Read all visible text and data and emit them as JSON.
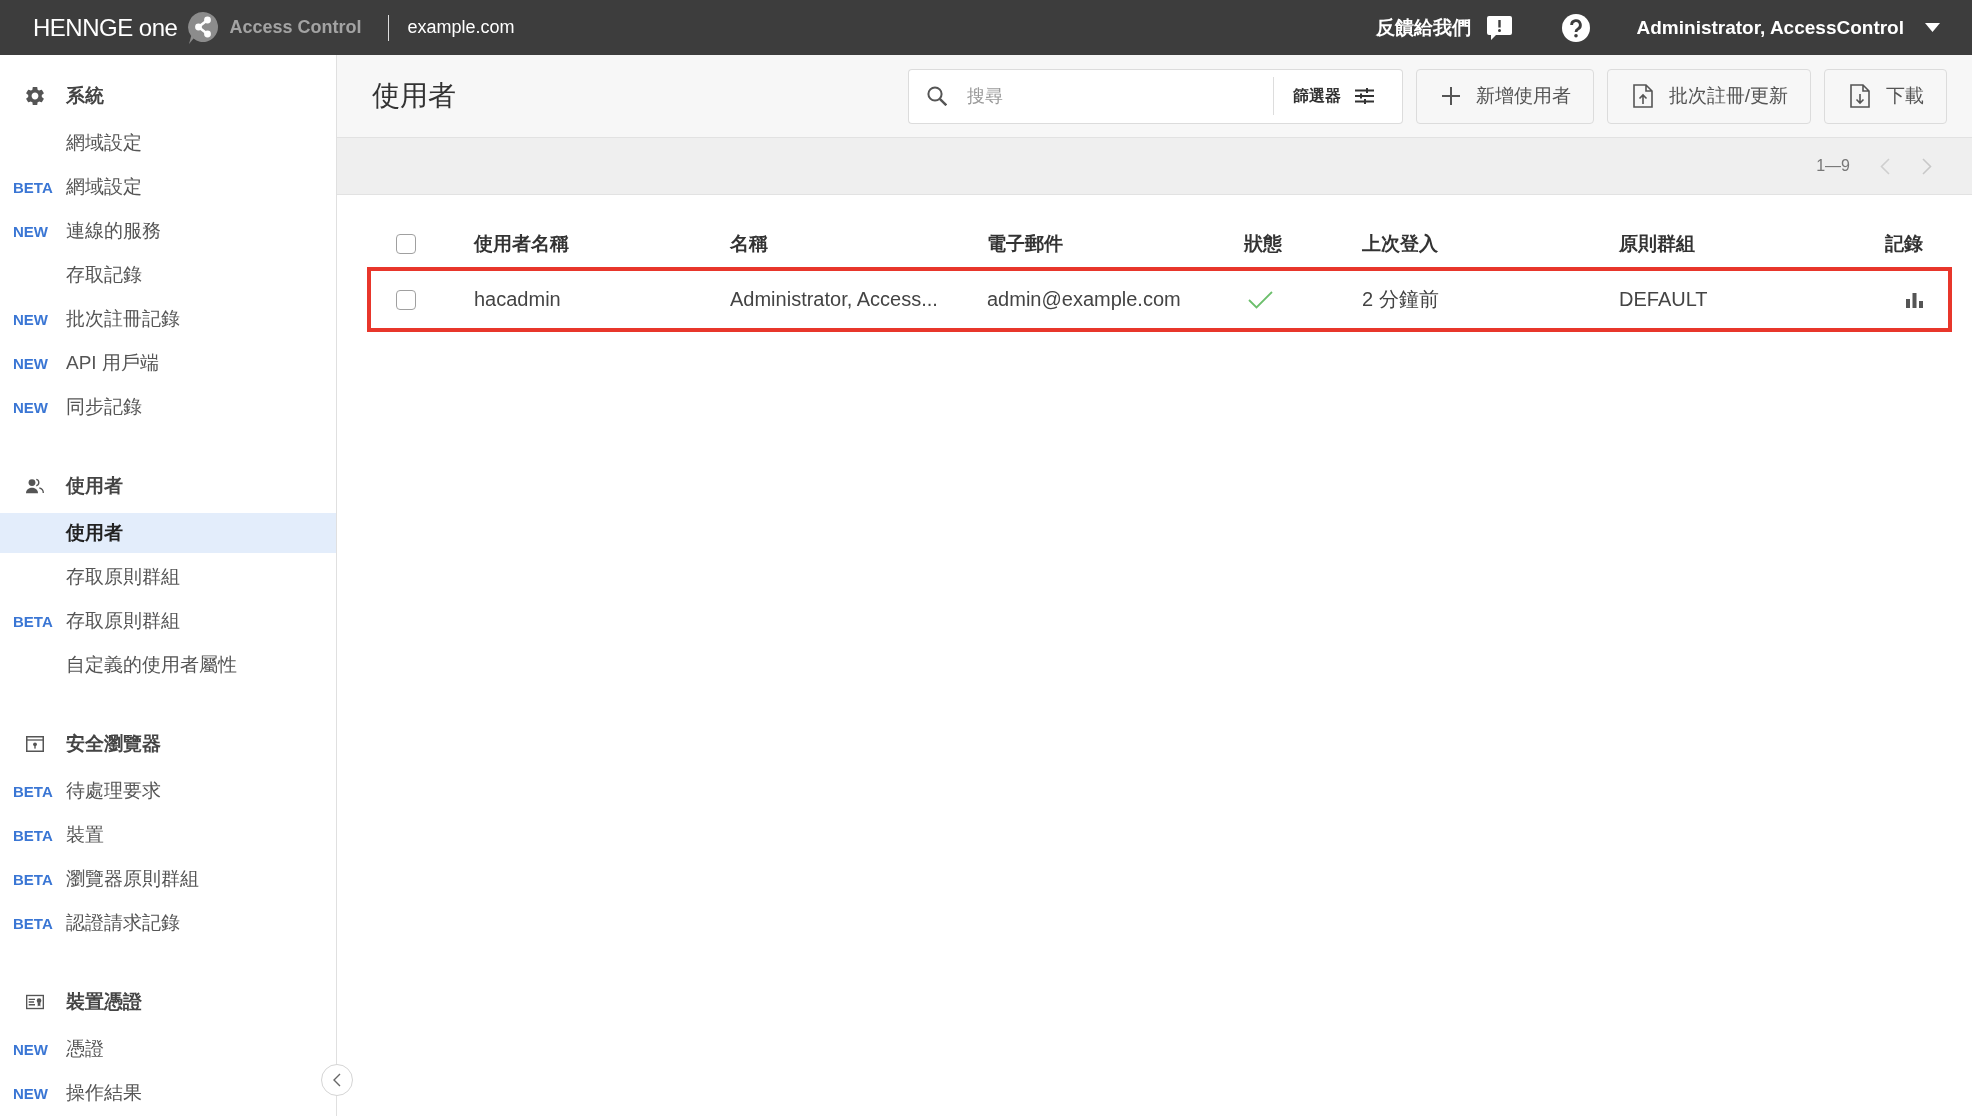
{
  "top_bar": {
    "logo": "HENNGE one",
    "product": "Access Control",
    "domain": "example.com",
    "feedback": "反饋給我們",
    "account": "Administrator, AccessControl"
  },
  "sidebar": {
    "sections": [
      {
        "title": "系統",
        "items": [
          {
            "label": "網域設定",
            "selected": false
          },
          {
            "badge": "BETA",
            "label": "網域設定",
            "selected": false
          },
          {
            "badge": "NEW",
            "label": "連線的服務",
            "selected": false
          },
          {
            "label": "存取記錄",
            "selected": false
          },
          {
            "badge": "NEW",
            "label": "批次註冊記錄",
            "selected": false
          },
          {
            "badge": "NEW",
            "label": "API 用戶端",
            "selected": false
          },
          {
            "badge": "NEW",
            "label": "同步記錄",
            "selected": false
          }
        ]
      },
      {
        "title": "使用者",
        "items": [
          {
            "label": "使用者",
            "selected": true
          },
          {
            "label": "存取原則群組",
            "selected": false
          },
          {
            "badge": "BETA",
            "label": "存取原則群組",
            "selected": false
          },
          {
            "label": "自定義的使用者屬性",
            "selected": false
          }
        ]
      },
      {
        "title": "安全瀏覽器",
        "items": [
          {
            "badge": "BETA",
            "label": "待處理要求",
            "selected": false
          },
          {
            "badge": "BETA",
            "label": "裝置",
            "selected": false
          },
          {
            "badge": "BETA",
            "label": "瀏覽器原則群組",
            "selected": false
          },
          {
            "badge": "BETA",
            "label": "認證請求記錄",
            "selected": false
          }
        ]
      },
      {
        "title": "裝置憑證",
        "items": [
          {
            "badge": "NEW",
            "label": "憑證",
            "selected": false
          },
          {
            "badge": "NEW",
            "label": "操作結果",
            "selected": false
          }
        ]
      }
    ]
  },
  "page": {
    "title": "使用者",
    "search": {
      "placeholder": "搜尋"
    },
    "filter": "篩選器",
    "actions": [
      {
        "kind": "add",
        "label": "新增使用者"
      },
      {
        "kind": "upload",
        "label": "批次註冊/更新"
      },
      {
        "kind": "download",
        "label": "下載"
      }
    ]
  },
  "pagination": {
    "range": "1—9",
    "prev_disabled": true,
    "next_disabled": true
  },
  "table": {
    "select_all": {
      "checked": false
    },
    "columns": [
      "使用者名稱",
      "名稱",
      "電子郵件",
      "狀態",
      "上次登入",
      "原則群組",
      "記錄"
    ],
    "rows": [
      {
        "checked": false,
        "highlighted": true,
        "username": "hacadmin",
        "name": "Administrator, Access...",
        "email": "admin@example.com",
        "active": true,
        "last_login": "2 分鐘前",
        "policy_group": "DEFAULT"
      }
    ]
  }
}
